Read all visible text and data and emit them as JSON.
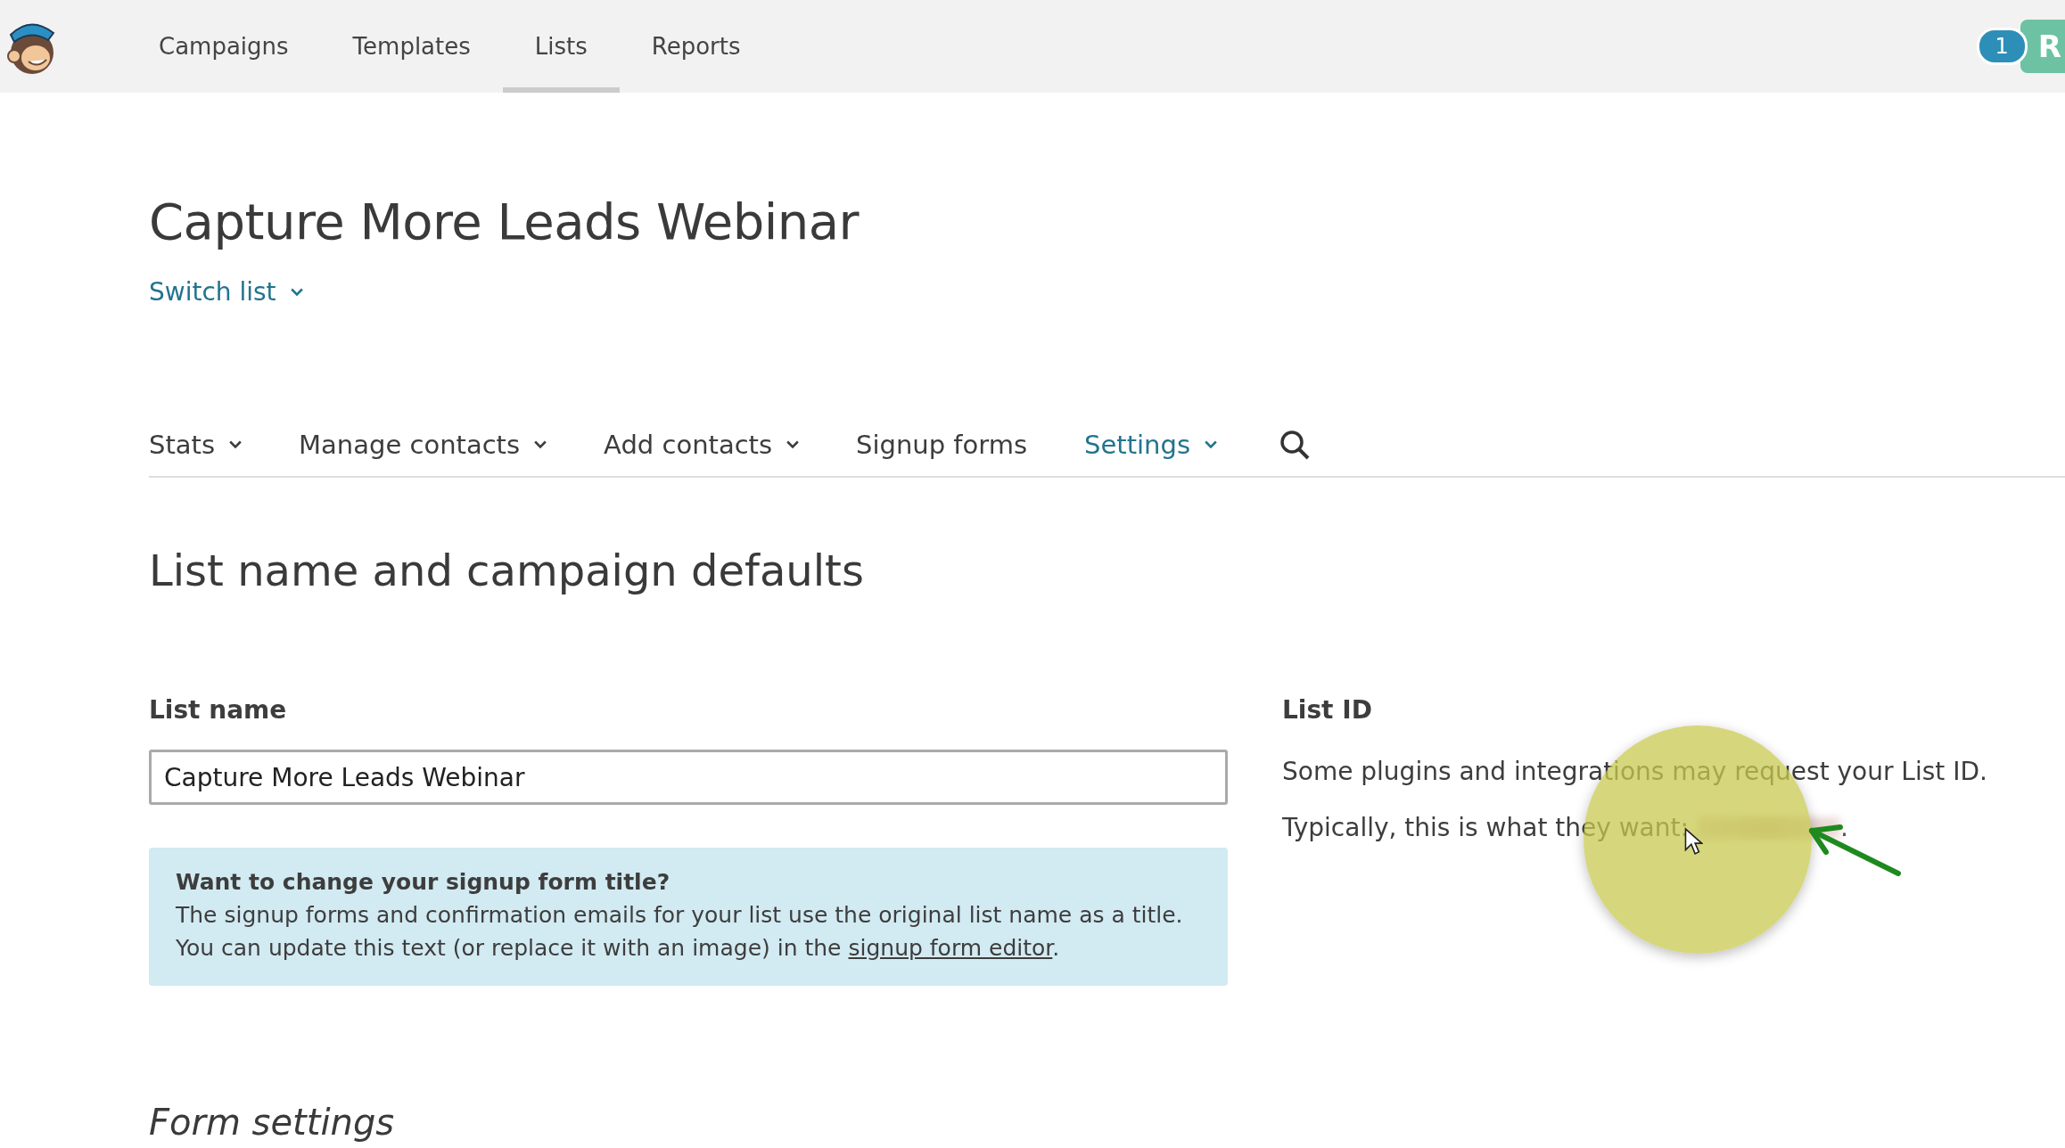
{
  "top_nav": {
    "items": [
      {
        "label": "Campaigns",
        "selected": false
      },
      {
        "label": "Templates",
        "selected": false
      },
      {
        "label": "Lists",
        "selected": true
      },
      {
        "label": "Reports",
        "selected": false
      }
    ],
    "notification_count": "1",
    "account_initial": "R"
  },
  "page": {
    "title": "Capture More Leads Webinar",
    "switch_list": "Switch list"
  },
  "sub_nav": {
    "items": [
      {
        "label": "Stats",
        "dropdown": true,
        "selected": false
      },
      {
        "label": "Manage contacts",
        "dropdown": true,
        "selected": false
      },
      {
        "label": "Add contacts",
        "dropdown": true,
        "selected": false
      },
      {
        "label": "Signup forms",
        "dropdown": false,
        "selected": false
      },
      {
        "label": "Settings",
        "dropdown": true,
        "selected": true
      }
    ]
  },
  "section": {
    "heading": "List name and campaign defaults",
    "list_name": {
      "label": "List name",
      "value": "Capture More Leads Webinar"
    },
    "notice": {
      "title": "Want to change your signup form title?",
      "body": "The signup forms and confirmation emails for your list use the original list name as a title. You can update this text (or replace it with an image) in the",
      "link": "signup form editor",
      "end": "."
    },
    "list_id": {
      "label": "List ID",
      "text": "Some plugins and integrations may request your List ID.",
      "typical": "Typically, this is what they want:",
      "end": "."
    }
  },
  "form_settings": {
    "heading": "Form settings"
  }
}
